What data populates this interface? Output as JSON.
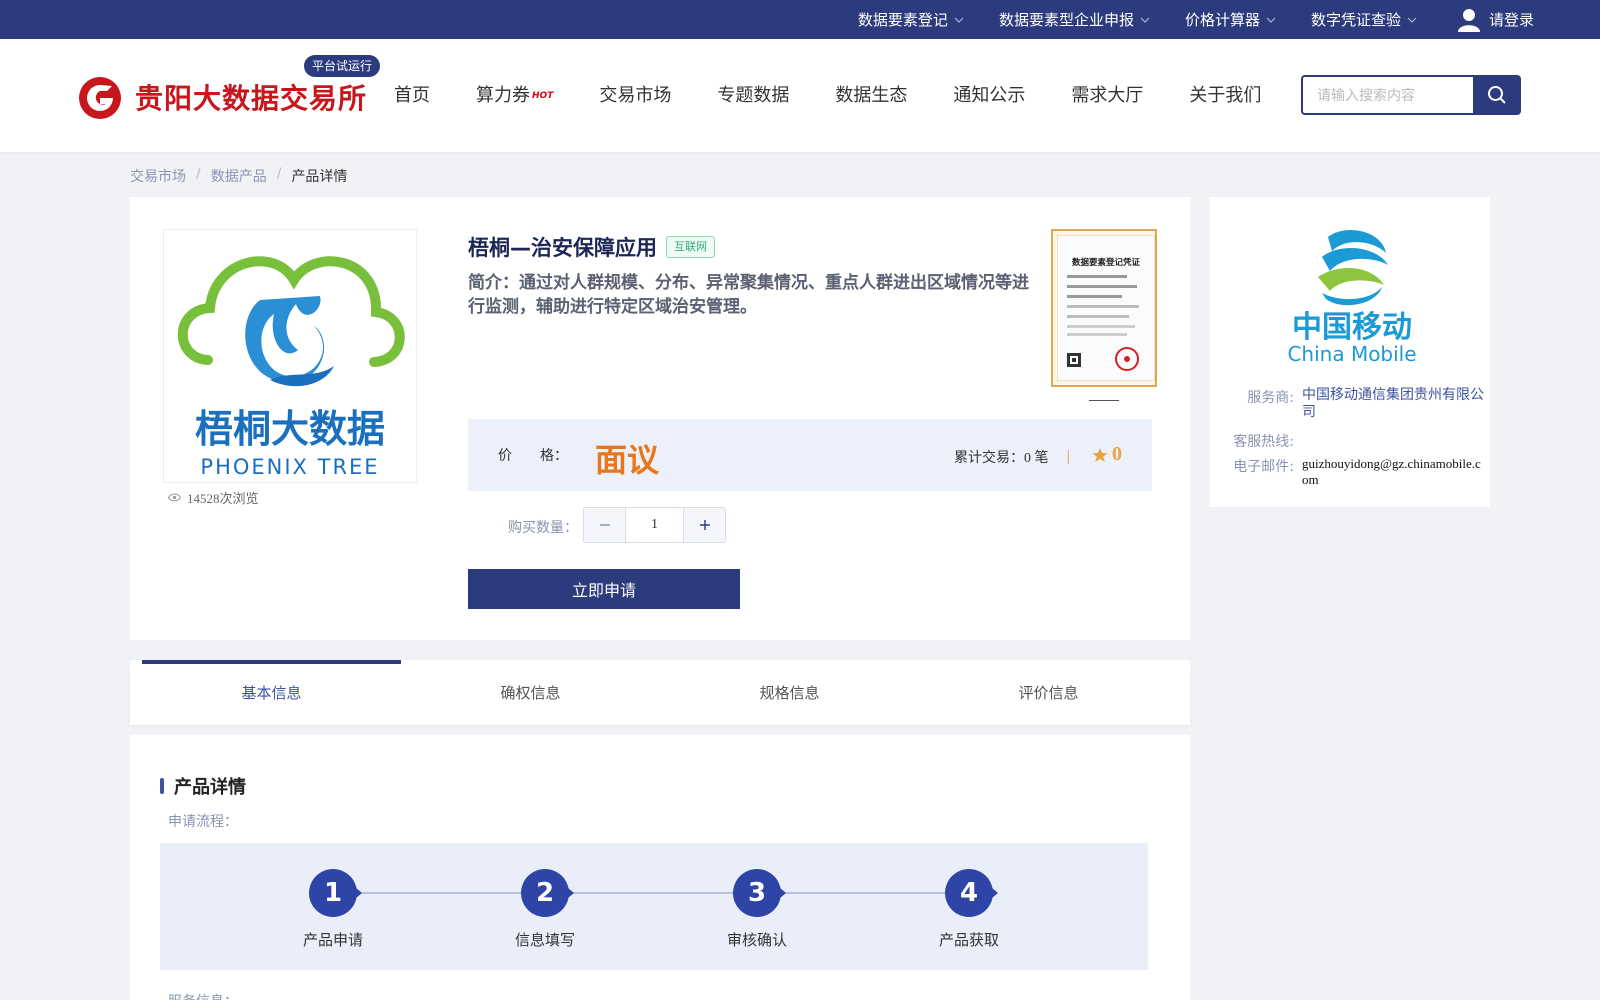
{
  "topbar": {
    "menu": [
      {
        "label": "数据要素登记"
      },
      {
        "label": "数据要素型企业申报"
      },
      {
        "label": "价格计算器"
      },
      {
        "label": "数字凭证查验"
      }
    ],
    "login_label": "请登录"
  },
  "header": {
    "brand": "贵阳大数据交易所",
    "trial_badge": "平台试运行",
    "nav": [
      {
        "label": "首页"
      },
      {
        "label": "算力券",
        "badge": "HOT"
      },
      {
        "label": "交易市场"
      },
      {
        "label": "专题数据"
      },
      {
        "label": "数据生态"
      },
      {
        "label": "通知公示"
      },
      {
        "label": "需求大厅"
      },
      {
        "label": "关于我们"
      }
    ],
    "search": {
      "placeholder": "请输入搜索内容",
      "value": ""
    }
  },
  "breadcrumb": [
    "交易市场",
    "数据产品",
    "产品详情"
  ],
  "product": {
    "title": "梧桐—治安保障应用",
    "tag": "互联网",
    "intro": "简介：通过对人群规模、分布、异常聚集情况、重点人群进出区域情况等进行监测，辅助进行特定区域治安管理。",
    "image_text_cn": "梧桐大数据",
    "image_text_en": "PHOENIX TREE",
    "views": "14528次浏览",
    "certificate_title": "数据要素登记凭证",
    "price_label": "价　　格：",
    "price_value": "面议",
    "deals": "累计交易：0 笔",
    "rating": "0",
    "qty_label": "购买数量：",
    "qty_value": "1",
    "apply_label": "立即申请"
  },
  "supplier": {
    "logo_cn": "中国移动",
    "logo_en": "China Mobile",
    "provider_label": "服务商:",
    "provider_value": "中国移动通信集团贵州有限公司",
    "hotline_label": "客服热线:",
    "hotline_value": "",
    "email_label": "电子邮件:",
    "email_value": "guizhouyidong@gz.chinamobile.com"
  },
  "tabs": [
    {
      "label": "基本信息",
      "active": true
    },
    {
      "label": "确权信息",
      "active": false
    },
    {
      "label": "规格信息",
      "active": false
    },
    {
      "label": "评价信息",
      "active": false
    }
  ],
  "details": {
    "section_title": "产品详情",
    "flow_label": "申请流程：",
    "steps": [
      {
        "number": "1",
        "label": "产品申请"
      },
      {
        "number": "2",
        "label": "信息填写"
      },
      {
        "number": "3",
        "label": "审核确认"
      },
      {
        "number": "4",
        "label": "产品获取"
      }
    ],
    "service_label": "服务信息："
  },
  "colors": {
    "primary": "#2b3b7d",
    "brand_red": "#c8161d",
    "price_orange": "#e8771b",
    "rating_gold": "#e8a33a",
    "tag_green": "#2faa74",
    "page_bg": "#f1f2f6"
  }
}
